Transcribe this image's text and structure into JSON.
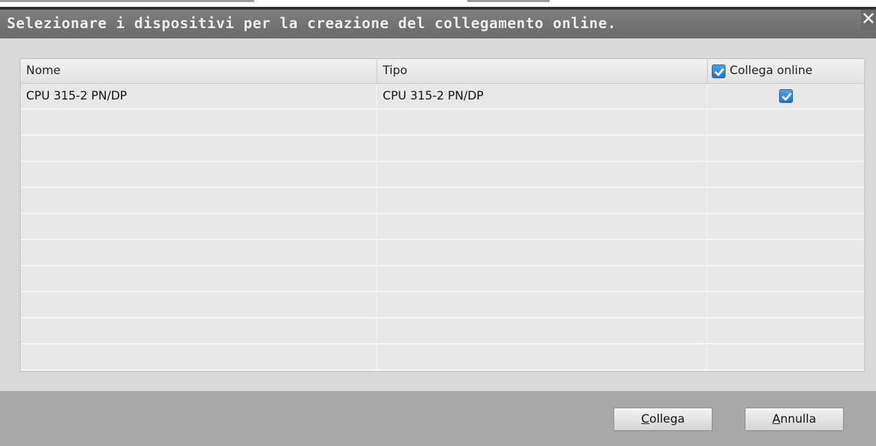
{
  "dialog": {
    "title": "Selezionare i dispositivi per la creazione del collegamento online.",
    "close_glyph": "✕"
  },
  "table": {
    "columns": [
      "Nome",
      "Tipo",
      "Collega online"
    ],
    "header_checkbox_checked": true,
    "rows": [
      {
        "nome": "CPU 315-2 PN/DP",
        "tipo": "CPU 315-2 PN/DP",
        "collega_online": true
      }
    ],
    "empty_rows": 10
  },
  "buttons": {
    "connect": {
      "mnemonic": "C",
      "rest": "ollega"
    },
    "cancel": {
      "mnemonic": "A",
      "rest": "nnulla"
    }
  },
  "colors": {
    "titlebar": "#6f6f6f",
    "checkbox": "#1d74c9"
  }
}
